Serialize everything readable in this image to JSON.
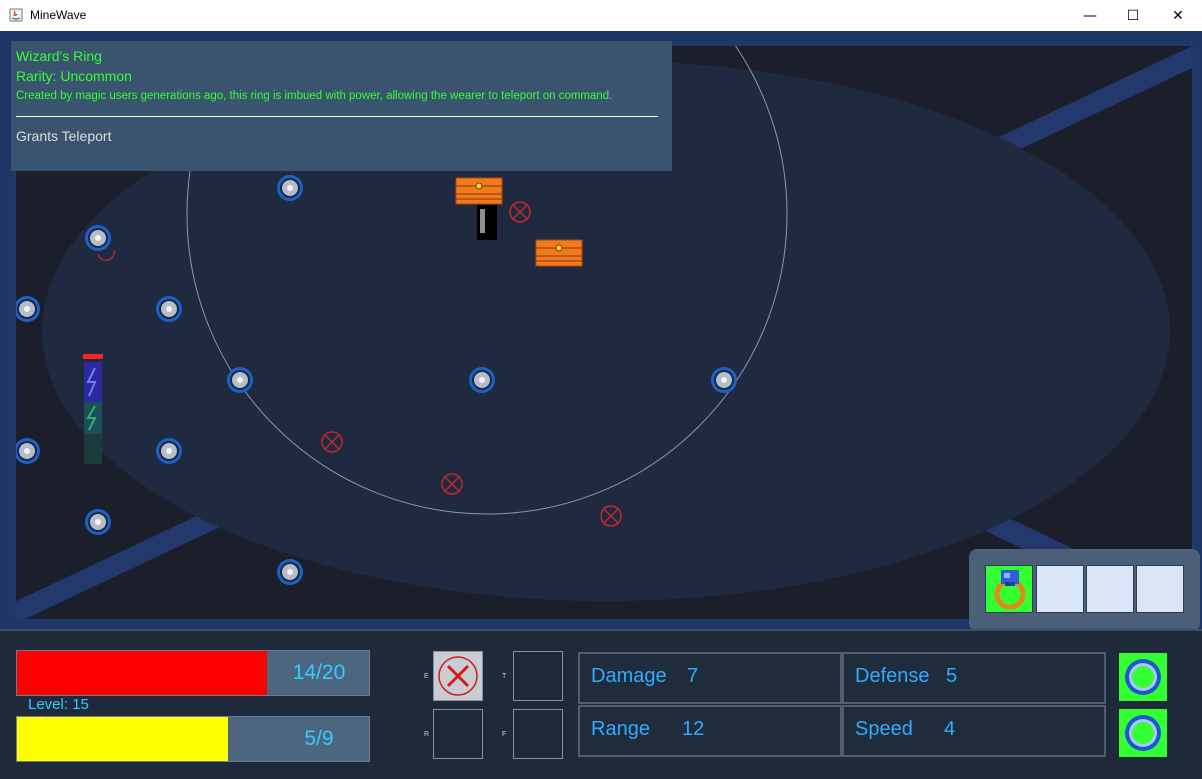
{
  "window": {
    "title": "MineWave",
    "minimize_glyph": "—",
    "maximize_glyph": "☐",
    "close_glyph": "✕"
  },
  "tooltip": {
    "item_name": "Wizard's Ring",
    "rarity": "Rarity: Uncommon",
    "description": "Created by magic users generations ago, this ring is imbued with power, allowing the wearer to teleport on command.",
    "effect": "Grants Teleport"
  },
  "hud": {
    "health": {
      "text": "14/20",
      "current": 14,
      "max": 20,
      "color": "#ff0000"
    },
    "level": "Level: 15",
    "experience": {
      "text": "5/9",
      "current": 5,
      "max": 9,
      "color": "#ffff00"
    },
    "ability_slots": [
      {
        "key": "E",
        "icon": "cancel-icon",
        "filled": true
      },
      {
        "key": "T",
        "icon": "",
        "filled": false
      },
      {
        "key": "R",
        "icon": "",
        "filled": false
      },
      {
        "key": "F",
        "icon": "",
        "filled": false
      }
    ],
    "stats": {
      "damage": {
        "label": "Damage",
        "value": "7"
      },
      "defense": {
        "label": "Defense",
        "value": "5"
      },
      "range": {
        "label": "Range",
        "value": "12"
      },
      "speed": {
        "label": "Speed",
        "value": "4"
      }
    },
    "gems": [
      {
        "icon": "gem-icon"
      },
      {
        "icon": "gem-icon"
      }
    ]
  },
  "equipment": {
    "slots": [
      {
        "icon": "ring-icon",
        "filled": true
      },
      {
        "filled": false
      },
      {
        "filled": false
      },
      {
        "filled": false
      }
    ]
  },
  "colors": {
    "text_green": "#33ff33",
    "text_blue": "#33ccff",
    "playfield": "#1b1f2c",
    "arena": "#1f2a40",
    "frame": "#1e3766"
  }
}
